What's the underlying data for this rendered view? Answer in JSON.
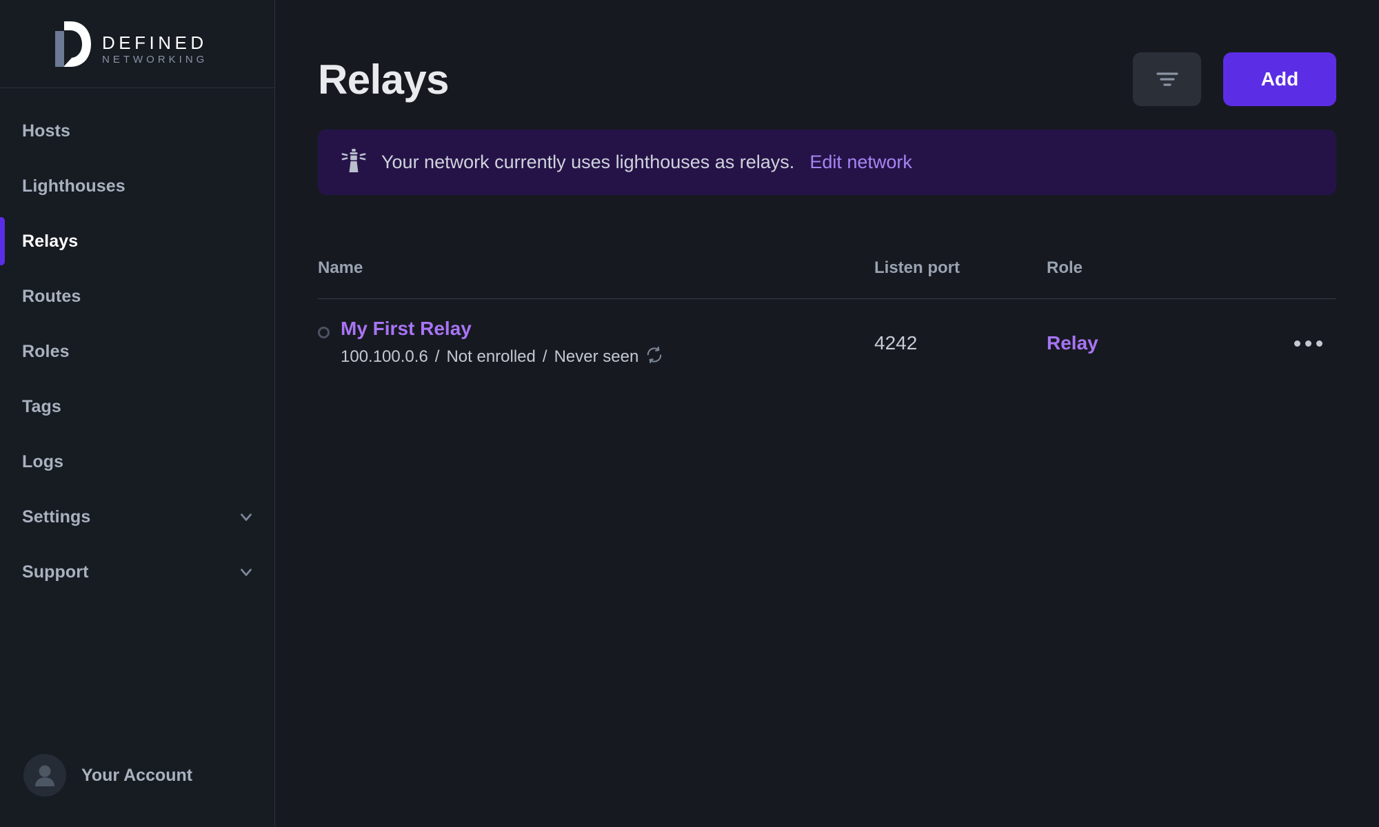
{
  "brand": {
    "line1": "DEFINED",
    "line2": "NETWORKING",
    "logo_icon": "defined-networking-logo"
  },
  "sidebar": {
    "items": [
      {
        "label": "Hosts",
        "active": false,
        "expandable": false
      },
      {
        "label": "Lighthouses",
        "active": false,
        "expandable": false
      },
      {
        "label": "Relays",
        "active": true,
        "expandable": false
      },
      {
        "label": "Routes",
        "active": false,
        "expandable": false
      },
      {
        "label": "Roles",
        "active": false,
        "expandable": false
      },
      {
        "label": "Tags",
        "active": false,
        "expandable": false
      },
      {
        "label": "Logs",
        "active": false,
        "expandable": false
      },
      {
        "label": "Settings",
        "active": false,
        "expandable": true
      },
      {
        "label": "Support",
        "active": false,
        "expandable": true
      }
    ],
    "account": {
      "label": "Your Account",
      "avatar_icon": "user-avatar-icon"
    },
    "active_indicator_color": "#5b2ee5"
  },
  "header": {
    "title": "Relays",
    "filter_icon": "filter-icon",
    "add_label": "Add",
    "add_color": "#5b2ee5"
  },
  "banner": {
    "icon": "lighthouse-icon",
    "text": "Your network currently uses lighthouses as relays.",
    "link_label": "Edit network",
    "background": "#251348",
    "link_color": "#a884f3"
  },
  "table": {
    "columns": [
      "Name",
      "Listen port",
      "Role"
    ],
    "rows": [
      {
        "status": "offline",
        "name": "My First Relay",
        "ip": "100.100.0.6",
        "enrollment": "Not enrolled",
        "last_seen": "Never seen",
        "refresh_icon": "refresh-icon",
        "listen_port": "4242",
        "role": "Relay",
        "menu_icon": "kebab-menu-icon"
      }
    ]
  }
}
